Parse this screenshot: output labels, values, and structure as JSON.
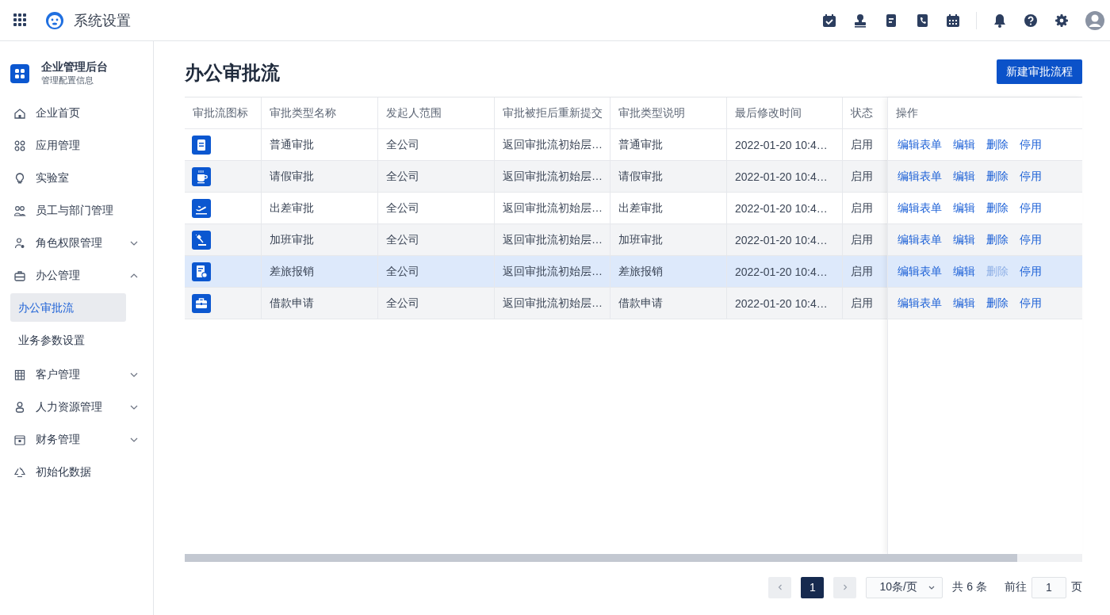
{
  "app_bar": {
    "title": "系统设置"
  },
  "sidebar": {
    "title": "企业管理后台",
    "subtitle": "管理配置信息",
    "items": [
      {
        "label": "企业首页",
        "kind": "link"
      },
      {
        "label": "应用管理",
        "kind": "link"
      },
      {
        "label": "实验室",
        "kind": "link"
      },
      {
        "label": "员工与部门管理",
        "kind": "link"
      },
      {
        "label": "角色权限管理",
        "kind": "group",
        "expanded": false
      },
      {
        "label": "办公管理",
        "kind": "group",
        "expanded": true,
        "children": [
          {
            "label": "办公审批流",
            "selected": true
          },
          {
            "label": "业务参数设置",
            "selected": false
          }
        ]
      },
      {
        "label": "客户管理",
        "kind": "group",
        "expanded": false
      },
      {
        "label": "人力资源管理",
        "kind": "group",
        "expanded": false
      },
      {
        "label": "财务管理",
        "kind": "group",
        "expanded": false
      },
      {
        "label": "初始化数据",
        "kind": "link"
      }
    ]
  },
  "page": {
    "title": "办公审批流",
    "primary_button": "新建审批流程"
  },
  "table": {
    "columns": [
      "审批流图标",
      "审批类型名称",
      "发起人范围",
      "审批被拒后重新提交",
      "审批类型说明",
      "最后修改时间",
      "状态",
      "操作"
    ],
    "rows": [
      {
        "highlighted": false,
        "cells": [
          "",
          "普通审批",
          "全公司",
          "返回审批流初始层…",
          "普通审批",
          "2022-01-20 10:4…",
          "启用"
        ],
        "actions": [
          {
            "label": "编辑表单",
            "disabled": false
          },
          {
            "label": "编辑",
            "disabled": false
          },
          {
            "label": "删除",
            "disabled": false
          },
          {
            "label": "停用",
            "disabled": false
          }
        ]
      },
      {
        "highlighted": false,
        "cells": [
          "",
          "请假审批",
          "全公司",
          "返回审批流初始层…",
          "请假审批",
          "2022-01-20 10:4…",
          "启用"
        ],
        "actions": [
          {
            "label": "编辑表单",
            "disabled": false
          },
          {
            "label": "编辑",
            "disabled": false
          },
          {
            "label": "删除",
            "disabled": false
          },
          {
            "label": "停用",
            "disabled": false
          }
        ]
      },
      {
        "highlighted": false,
        "cells": [
          "",
          "出差审批",
          "全公司",
          "返回审批流初始层…",
          "出差审批",
          "2022-01-20 10:4…",
          "启用"
        ],
        "actions": [
          {
            "label": "编辑表单",
            "disabled": false
          },
          {
            "label": "编辑",
            "disabled": false
          },
          {
            "label": "删除",
            "disabled": false
          },
          {
            "label": "停用",
            "disabled": false
          }
        ]
      },
      {
        "highlighted": false,
        "cells": [
          "",
          "加班审批",
          "全公司",
          "返回审批流初始层…",
          "加班审批",
          "2022-01-20 10:4…",
          "启用"
        ],
        "actions": [
          {
            "label": "编辑表单",
            "disabled": false
          },
          {
            "label": "编辑",
            "disabled": false
          },
          {
            "label": "删除",
            "disabled": false
          },
          {
            "label": "停用",
            "disabled": false
          }
        ]
      },
      {
        "highlighted": true,
        "cells": [
          "",
          "差旅报销",
          "全公司",
          "返回审批流初始层…",
          "差旅报销",
          "2022-01-20 10:4…",
          "启用"
        ],
        "actions": [
          {
            "label": "编辑表单",
            "disabled": false
          },
          {
            "label": "编辑",
            "disabled": false
          },
          {
            "label": "删除",
            "disabled": true
          },
          {
            "label": "停用",
            "disabled": false
          }
        ]
      },
      {
        "highlighted": false,
        "cells": [
          "",
          "借款申请",
          "全公司",
          "返回审批流初始层…",
          "借款申请",
          "2022-01-20 10:4…",
          "启用"
        ],
        "actions": [
          {
            "label": "编辑表单",
            "disabled": false
          },
          {
            "label": "编辑",
            "disabled": false
          },
          {
            "label": "删除",
            "disabled": false
          },
          {
            "label": "停用",
            "disabled": false
          }
        ]
      }
    ]
  },
  "pagination": {
    "pages": [
      {
        "label": "1",
        "selected": true
      }
    ],
    "page_size": "10条/页",
    "total": "共 6 条",
    "goto_label": "前往",
    "goto_value": "1",
    "goto_suffix": "页"
  }
}
